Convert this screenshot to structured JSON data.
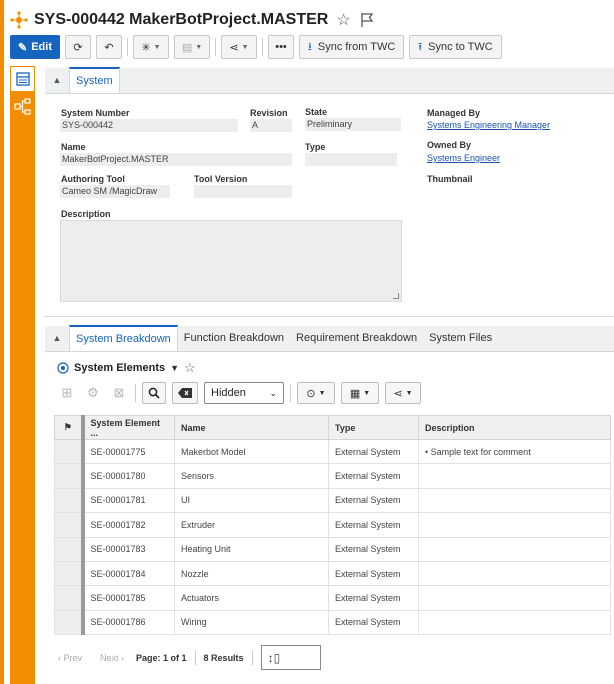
{
  "header": {
    "title": "SYS-000442 MakerBotProject.MASTER"
  },
  "toolbar": {
    "edit_label": "Edit",
    "sync_from_label": "Sync from TWC",
    "sync_to_label": "Sync to TWC"
  },
  "system_section": {
    "tab": "System",
    "fields": {
      "system_number_label": "System Number",
      "system_number_value": "SYS-000442",
      "revision_label": "Revision",
      "revision_value": "A",
      "state_label": "State",
      "state_value": "Preliminary",
      "managed_by_label": "Managed By",
      "managed_by_value": "Systems Engineering Manager",
      "name_label": "Name",
      "name_value": "MakerBotProject.MASTER",
      "type_label": "Type",
      "type_value": "",
      "owned_by_label": "Owned By",
      "owned_by_value": "Systems Engineer",
      "authoring_tool_label": "Authoring Tool",
      "authoring_tool_value": "Cameo SM /MagicDraw",
      "tool_version_label": "Tool Version",
      "tool_version_value": "",
      "thumbnail_label": "Thumbnail",
      "description_label": "Description"
    }
  },
  "breakdown_section": {
    "tabs": [
      "System Breakdown",
      "Function Breakdown",
      "Requirement Breakdown",
      "System Files"
    ],
    "view_name": "System Elements",
    "filter_value": "Hidden",
    "columns": [
      "System Element ...",
      "Name",
      "Type",
      "Description"
    ],
    "rows": [
      {
        "id": "SE-00001775",
        "name": "Makerbot Model",
        "type": "External System",
        "description": "• Sample text for comment"
      },
      {
        "id": "SE-00001780",
        "name": "Sensors",
        "type": "External System",
        "description": ""
      },
      {
        "id": "SE-00001781",
        "name": "UI",
        "type": "External System",
        "description": ""
      },
      {
        "id": "SE-00001782",
        "name": "Extruder",
        "type": "External System",
        "description": ""
      },
      {
        "id": "SE-00001783",
        "name": "Heating Unit",
        "type": "External System",
        "description": ""
      },
      {
        "id": "SE-00001784",
        "name": "Nozzle",
        "type": "External System",
        "description": ""
      },
      {
        "id": "SE-00001785",
        "name": "Actuators",
        "type": "External System",
        "description": ""
      },
      {
        "id": "SE-00001786",
        "name": "Wiring",
        "type": "External System",
        "description": ""
      }
    ],
    "pager": {
      "prev": "‹ Prev",
      "next": "Next ›",
      "page": "Page: 1 of 1",
      "results": "8 Results"
    }
  },
  "colors": {
    "accent": "#1565c0",
    "orange": "#f28c00"
  }
}
